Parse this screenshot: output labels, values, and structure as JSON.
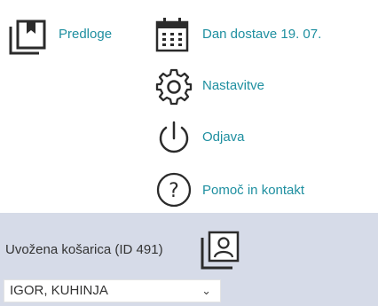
{
  "menu": {
    "templates": {
      "label": "Predloge",
      "icon": "bookmark-book-icon"
    },
    "delivery": {
      "label": "Dan dostave 19. 07.",
      "icon": "calendar-icon"
    },
    "settings": {
      "label": "Nastavitve",
      "icon": "gear-icon"
    },
    "logout": {
      "label": "Odjava",
      "icon": "power-icon"
    },
    "help": {
      "label": "Pomoč in kontakt",
      "icon": "question-circle-icon"
    }
  },
  "cart": {
    "label": "Uvožena košarica (ID 491)",
    "icon": "user-contact-card-icon",
    "selected_location": "IGOR, KUHINJA"
  },
  "colors": {
    "accent": "#1e8fa0",
    "panel_bg": "#d6dbe8",
    "icon": "#2b2b2b"
  }
}
